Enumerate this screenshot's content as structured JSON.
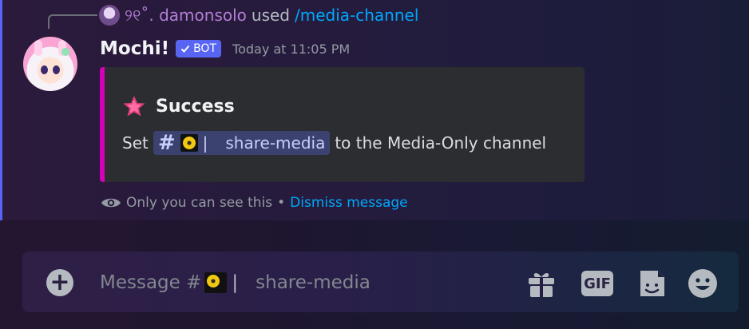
{
  "reply": {
    "username": "୨୧˚. damonsolo",
    "used_text": "used",
    "command": "/media-channel"
  },
  "message": {
    "author": "Mochi!",
    "bot_tag": "BOT",
    "timestamp": "Today at 11:05 PM"
  },
  "embed": {
    "accent_color": "#d600b9",
    "title": "Success",
    "desc_prefix": "Set",
    "channel_name": "share-media",
    "desc_suffix": "to the Media-Only channel"
  },
  "ephemeral": {
    "notice": "Only you can see this",
    "separator": "•",
    "dismiss": "Dismiss message"
  },
  "composer": {
    "placeholder_prefix": "Message #",
    "placeholder_channel": "share-media",
    "gif_label": "GIF"
  },
  "colors": {
    "blurple": "#5865f2",
    "link": "#00a8fc",
    "reply_user": "#b47ed6"
  }
}
